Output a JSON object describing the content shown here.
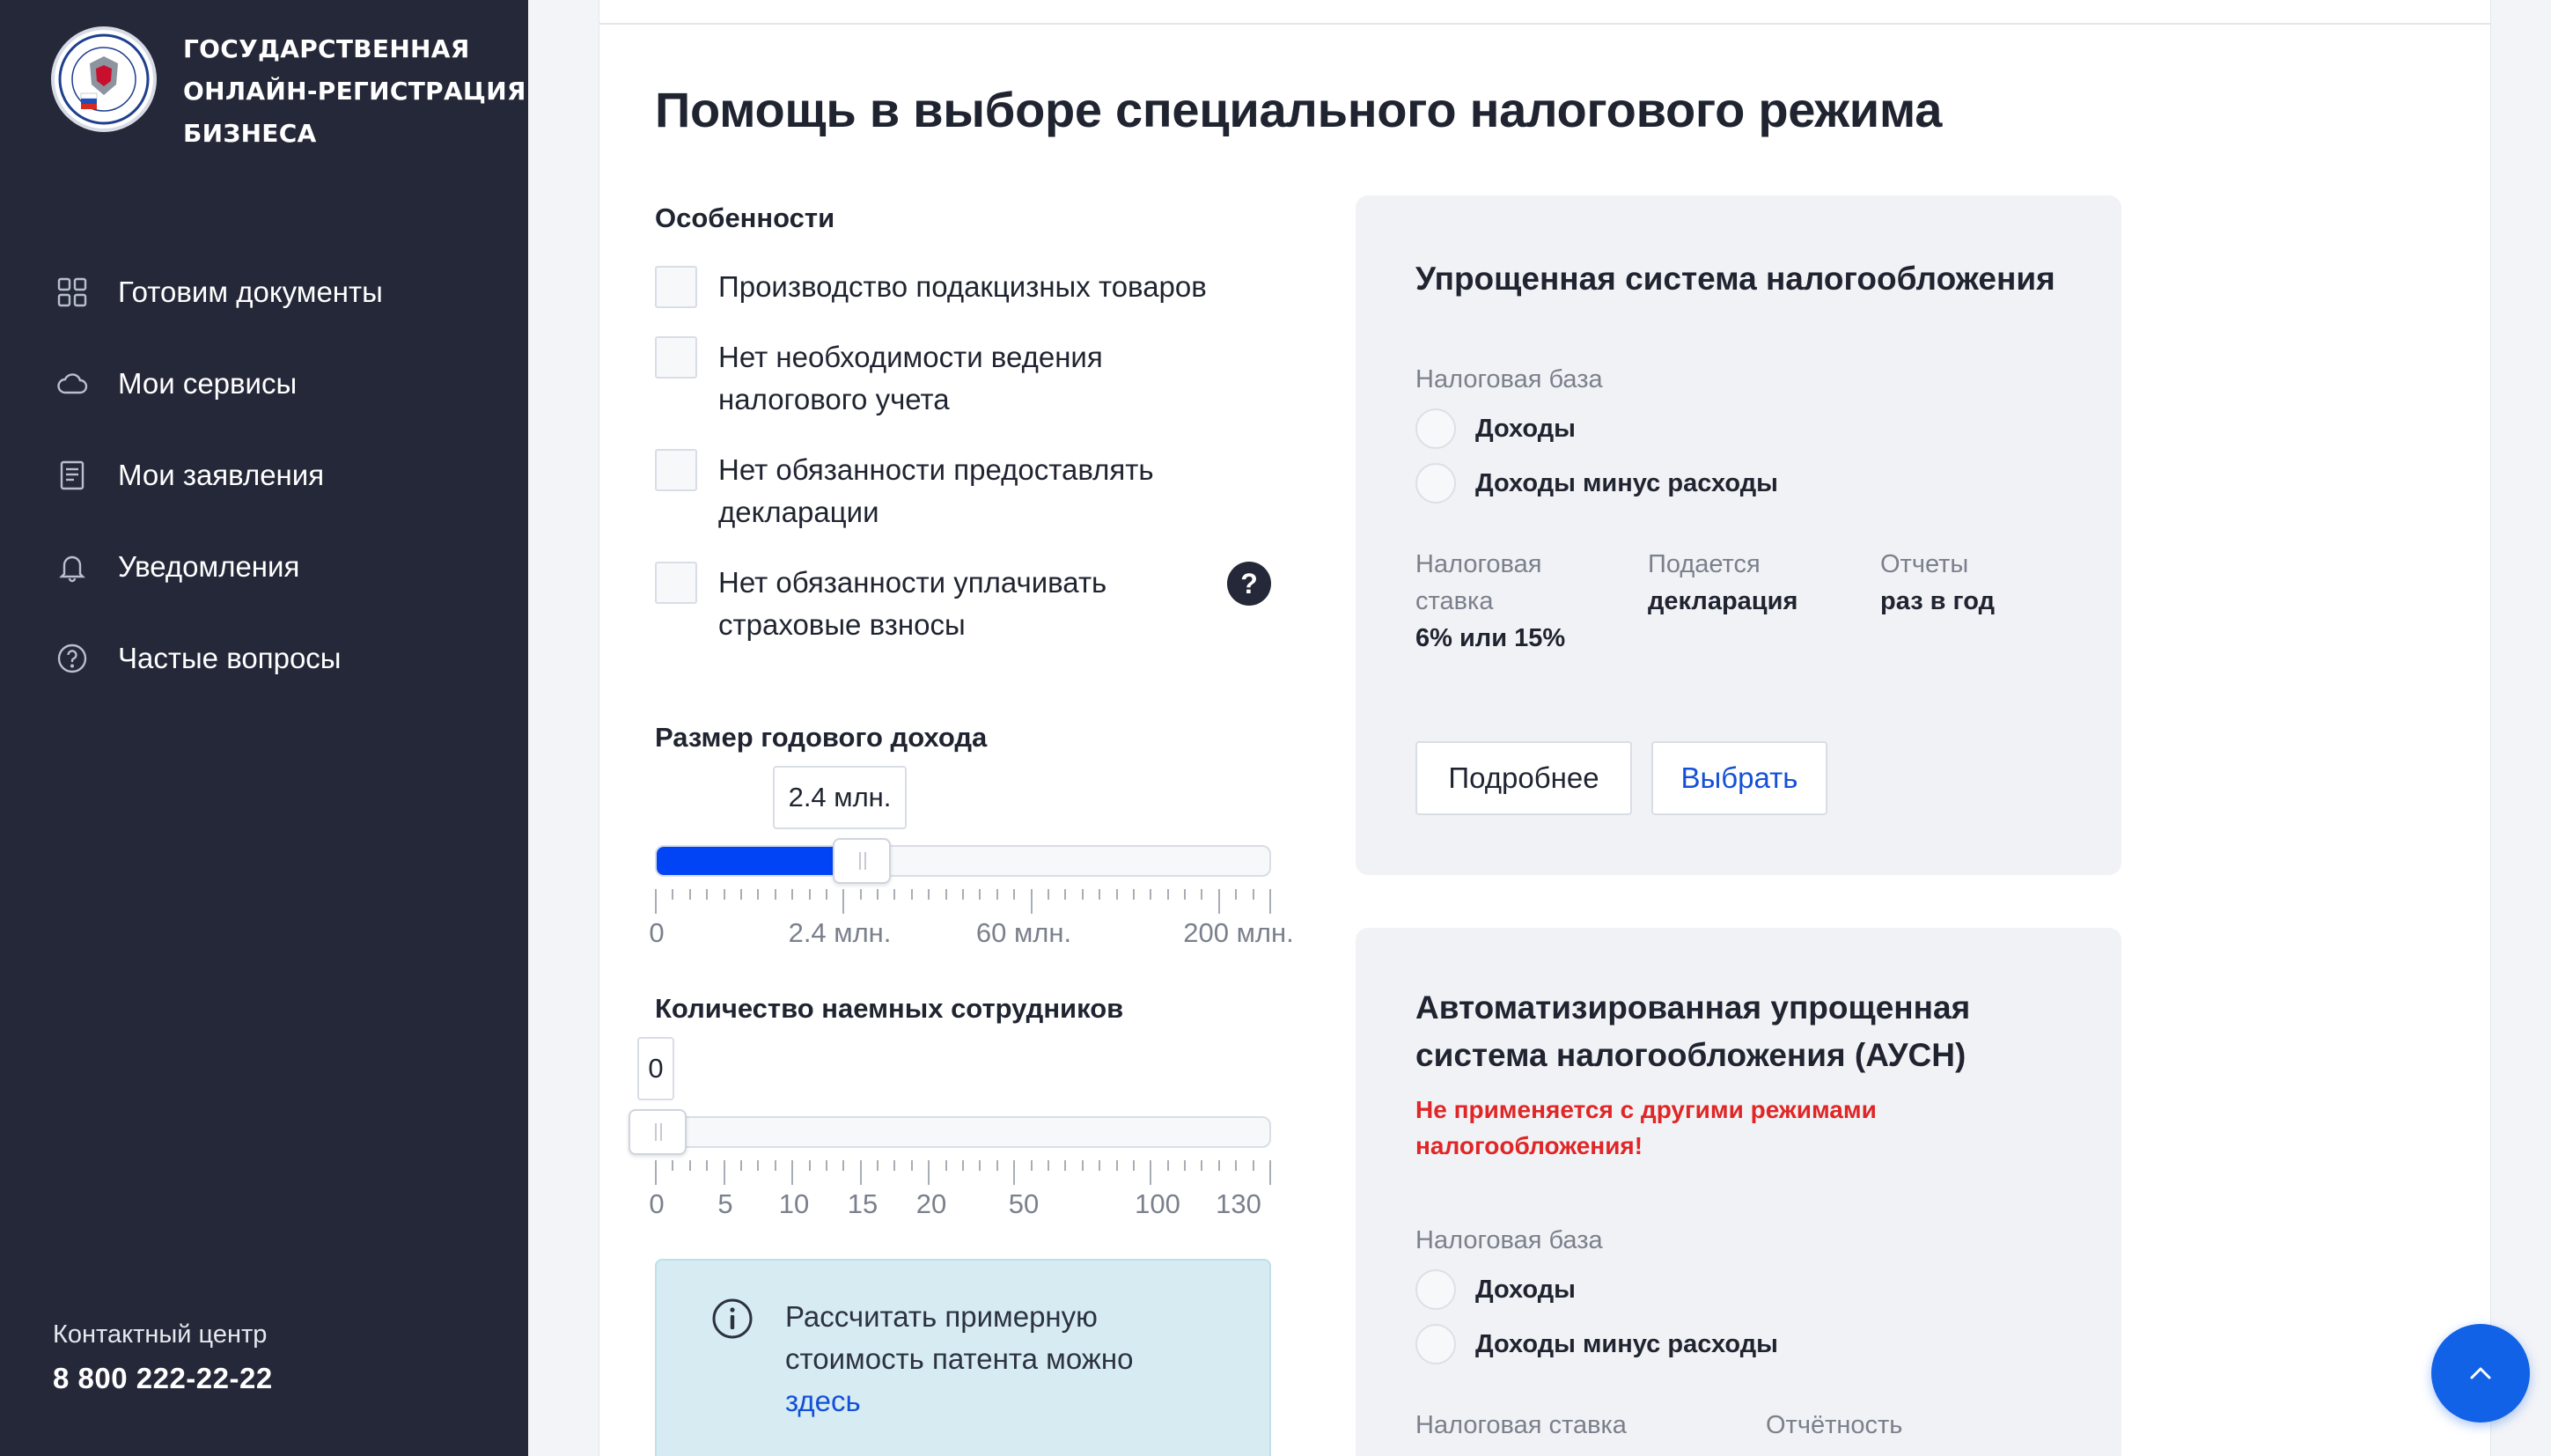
{
  "brand": {
    "line1": "Государственная",
    "line2": "онлайн-регистрация",
    "line3": "бизнеса"
  },
  "nav": [
    {
      "label": "Готовим документы",
      "icon": "grid-icon"
    },
    {
      "label": "Мои сервисы",
      "icon": "cloud-icon"
    },
    {
      "label": "Мои заявления",
      "icon": "document-list-icon"
    },
    {
      "label": "Уведомления",
      "icon": "bell-icon"
    },
    {
      "label": "Частые вопросы",
      "icon": "question-circle-icon"
    }
  ],
  "contact": {
    "label": "Контактный центр",
    "phone": "8 800 222-22-22"
  },
  "page": {
    "title": "Помощь в выборе специального налогового режима"
  },
  "features": {
    "title": "Особенности",
    "items": [
      "Производство подакцизных товаров",
      "Нет необходимости ведения налогового учета",
      "Нет обязанности предоставлять декларации",
      "Нет обязанности уплачивать страховые взносы"
    ],
    "help": "?"
  },
  "income_slider": {
    "title": "Размер годового дохода",
    "value_label": "2.4 млн.",
    "fill_fraction": 0.3,
    "ticks": [
      "0",
      "2.4 млн.",
      "60 млн.",
      "200 млн."
    ]
  },
  "employees_slider": {
    "title": "Количество наемных сотрудников",
    "value_label": "0",
    "fill_fraction": 0.0,
    "ticks": [
      "0",
      "5",
      "10",
      "15",
      "20",
      "50",
      "100",
      "130"
    ]
  },
  "info": {
    "text": "Рассчитать примерную стоимость патента можно",
    "link": "здесь"
  },
  "card_usn": {
    "title": "Упрощенная система налогообложения",
    "base_label": "Налоговая база",
    "base_options": [
      "Доходы",
      "Доходы минус расходы"
    ],
    "rate_label": "Налоговая ставка",
    "rate_value": "6% или 15%",
    "filed_label": "Подается",
    "filed_value": "декларация",
    "reports_label": "Отчеты",
    "reports_value": "раз в год",
    "more_button": "Подробнее",
    "choose_button": "Выбрать"
  },
  "card_ausn": {
    "title": "Автоматизированная упрощенная система налогообложения (АУСН)",
    "warning": "Не применяется с другими режимами налогообложения!",
    "base_label": "Налоговая база",
    "base_options": [
      "Доходы",
      "Доходы минус расходы"
    ],
    "rate_label": "Налоговая ставка",
    "reporting_label": "Отчётность"
  },
  "colors": {
    "sidebar": "#242838",
    "accent": "#0044f5",
    "warning": "#e02626",
    "link": "#1450d8"
  }
}
